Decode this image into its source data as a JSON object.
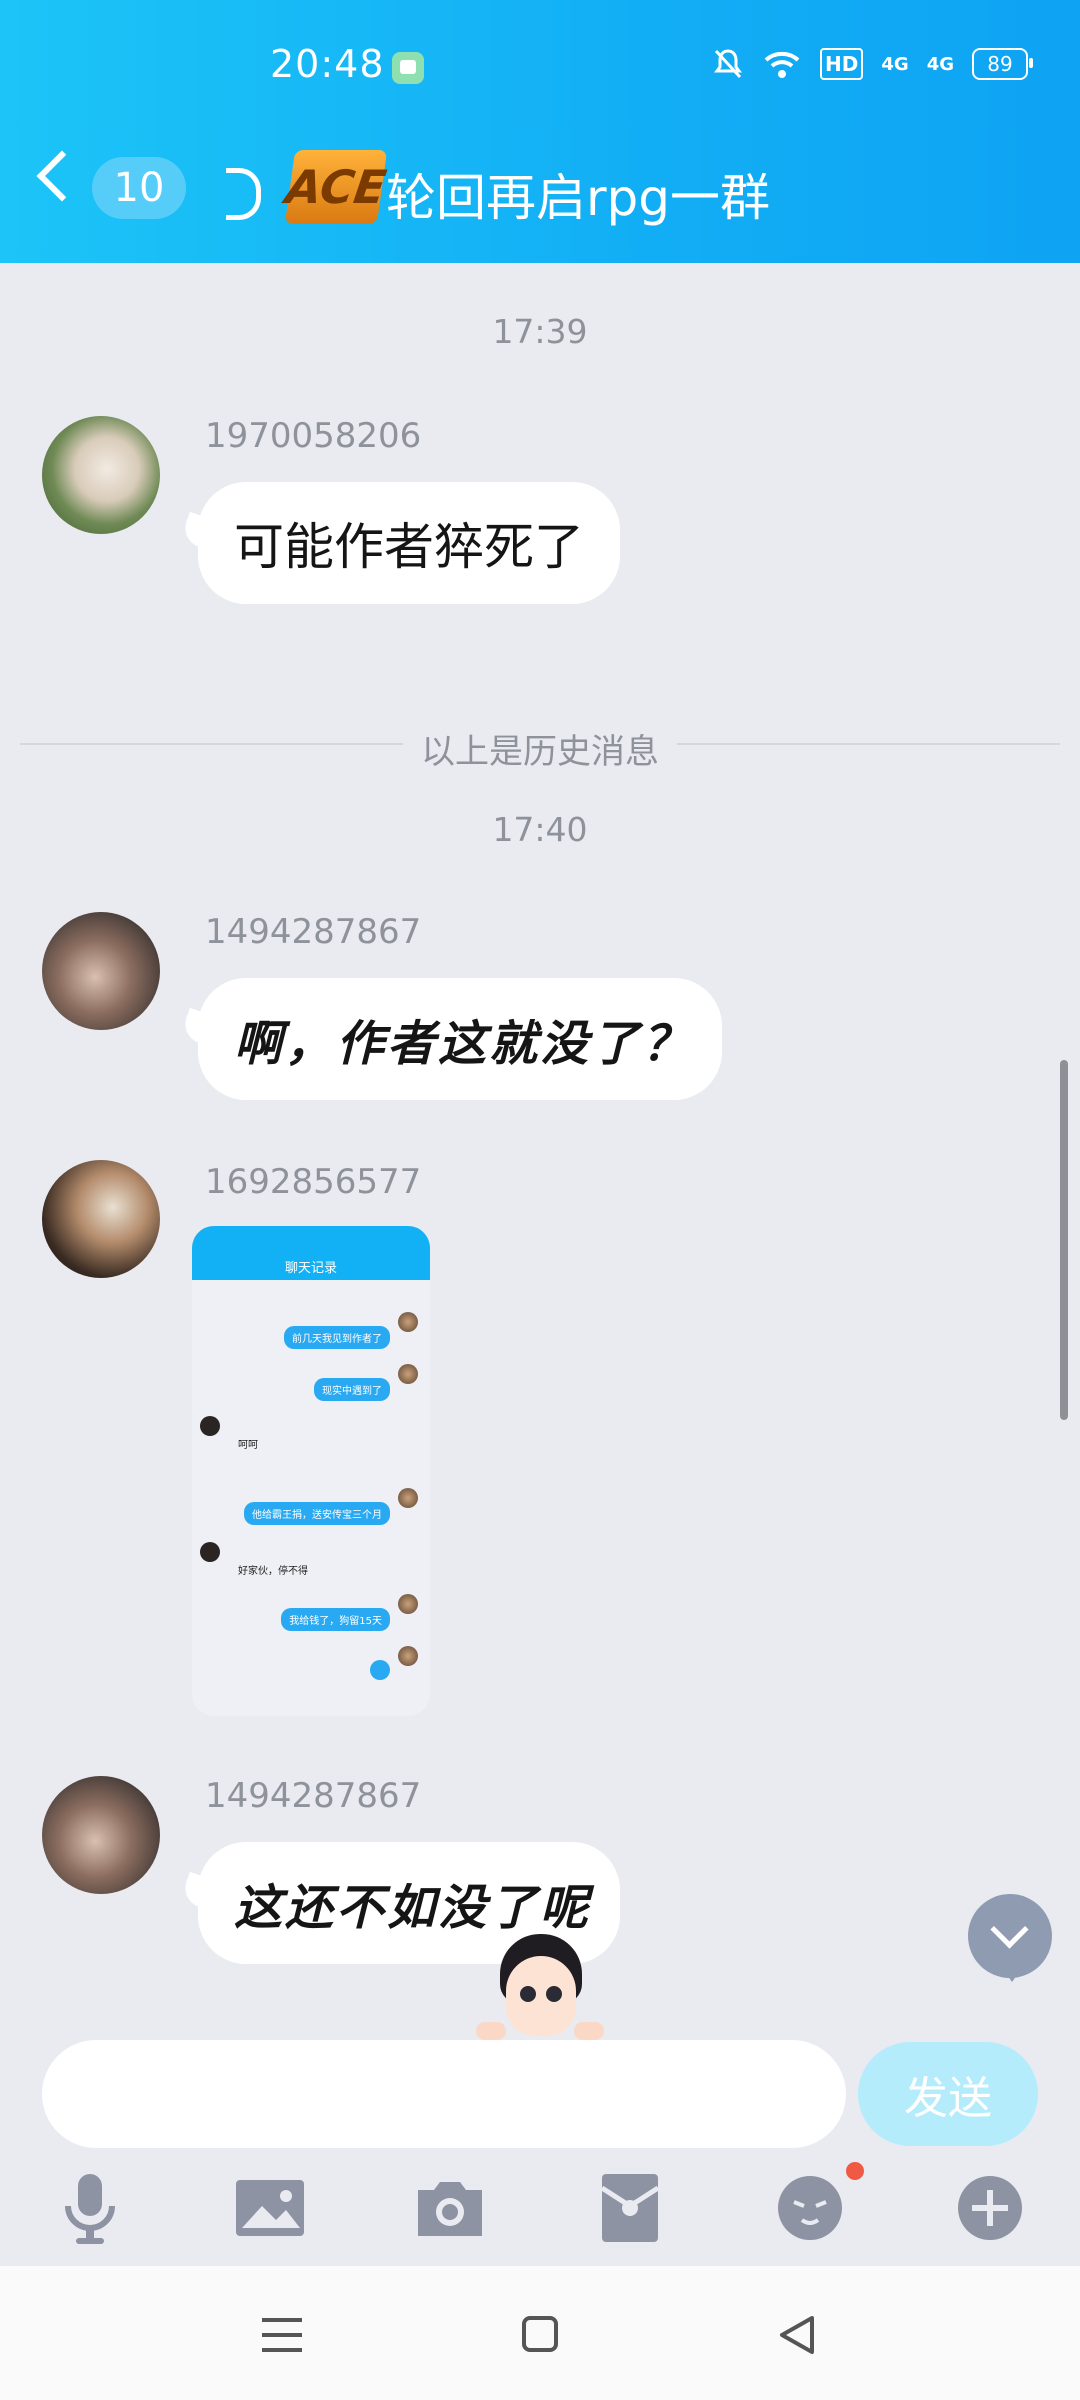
{
  "status_bar": {
    "time": "20:48",
    "hd_badge": "HD",
    "signal1": "4G",
    "signal2": "4G",
    "battery": "89"
  },
  "header": {
    "unread_count": "10",
    "group_title": "轮回再启rpg一群",
    "logo_text": "ACE"
  },
  "chat": {
    "time1": "17:39",
    "history_divider": "以上是历史消息",
    "time2": "17:40",
    "messages": [
      {
        "uid": "1970058206",
        "text": "可能作者猝死了"
      },
      {
        "uid": "1494287867",
        "text": "啊，作者这就没了？"
      },
      {
        "uid": "1692856577",
        "text": ""
      },
      {
        "uid": "1494287867",
        "text": "这还不如没了呢"
      }
    ],
    "screenshot": {
      "title": "聊天记录",
      "lines": [
        "前几天我见到作者了",
        "现实中遇到了",
        "呵呵",
        "他给霸王捐，送安传宝三个月",
        "好家伙，停不得",
        "我给钱了，狗留15天"
      ]
    }
  },
  "composer": {
    "input_value": "",
    "send_label": "发送"
  },
  "toolbar_icons": [
    "microphone-icon",
    "image-icon",
    "camera-icon",
    "red-packet-icon",
    "emoji-icon",
    "plus-icon"
  ],
  "colors": {
    "header_gradient_start": "#1cc4f7",
    "header_gradient_end": "#0ea3f3",
    "send_button": "#b4ecfc",
    "chat_background": "#e9ebf1"
  }
}
